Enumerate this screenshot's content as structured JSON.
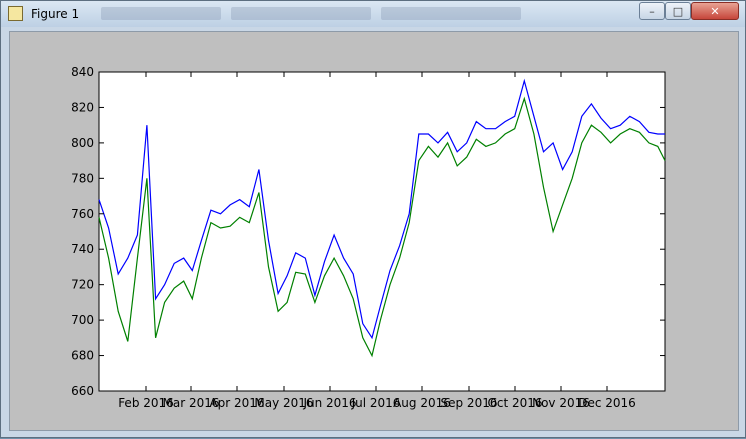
{
  "window": {
    "title": "Figure 1",
    "minimize": "–",
    "maximize": "□",
    "close": "✕"
  },
  "icons": {
    "app": "matplotlib-figure-icon"
  },
  "colors": {
    "series1": "#0000ff",
    "series2": "#008000",
    "background": "#bfbfbf"
  },
  "chart_data": {
    "type": "line",
    "title": "",
    "xlabel": "",
    "ylabel": "",
    "x": [
      "2016-01-04",
      "2016-01-12",
      "2016-01-20",
      "2016-01-28",
      "2016-02-05",
      "2016-02-12",
      "2016-02-20",
      "2016-02-28",
      "2016-03-06",
      "2016-03-14",
      "2016-03-22",
      "2016-03-30",
      "2016-04-07",
      "2016-04-15",
      "2016-04-23",
      "2016-05-01",
      "2016-05-08",
      "2016-05-16",
      "2016-05-24",
      "2016-06-01",
      "2016-06-09",
      "2016-06-17",
      "2016-06-25",
      "2016-07-02",
      "2016-07-10",
      "2016-07-18",
      "2016-07-26",
      "2016-08-03",
      "2016-08-11",
      "2016-08-19",
      "2016-08-27",
      "2016-09-04",
      "2016-09-12",
      "2016-09-20",
      "2016-09-28",
      "2016-10-06",
      "2016-10-14",
      "2016-10-22",
      "2016-10-30",
      "2016-11-07",
      "2016-11-15",
      "2016-11-23",
      "2016-12-01",
      "2016-12-09",
      "2016-12-17",
      "2016-12-25",
      "2016-12-31"
    ],
    "series": [
      {
        "values": [
          768,
          752,
          726,
          735,
          748,
          810,
          712,
          720,
          732,
          735,
          728,
          745,
          762,
          760,
          765,
          768,
          764,
          785,
          745,
          715,
          725,
          738,
          735,
          714,
          733,
          748,
          735,
          726,
          698,
          690,
          708,
          728,
          742,
          760,
          805,
          805,
          800,
          806,
          795,
          800,
          812,
          808,
          808,
          812,
          815,
          835,
          815,
          795,
          800,
          785,
          795,
          815,
          822,
          814,
          808,
          810,
          815,
          812,
          806,
          805,
          805
        ]
      },
      {
        "values": [
          758,
          735,
          705,
          688,
          735,
          780,
          690,
          710,
          718,
          722,
          712,
          735,
          755,
          752,
          753,
          758,
          755,
          772,
          730,
          705,
          710,
          727,
          726,
          710,
          725,
          735,
          725,
          712,
          690,
          680,
          700,
          720,
          735,
          755,
          790,
          798,
          792,
          800,
          787,
          792,
          802,
          798,
          800,
          805,
          808,
          825,
          805,
          775,
          750,
          765,
          780,
          800,
          810,
          806,
          800,
          805,
          808,
          806,
          800,
          798,
          790
        ]
      }
    ],
    "x_ticks": [
      "Feb 2016",
      "Mar 2016",
      "Apr 2016",
      "May 2016",
      "Jun 2016",
      "Jul 2016",
      "Aug 2016",
      "Sep 2016",
      "Oct 2016",
      "Nov 2016",
      "Dec 2016"
    ],
    "y_ticks": [
      "660",
      "680",
      "700",
      "720",
      "740",
      "760",
      "780",
      "800",
      "820",
      "840"
    ],
    "ylim": [
      660,
      840
    ]
  }
}
